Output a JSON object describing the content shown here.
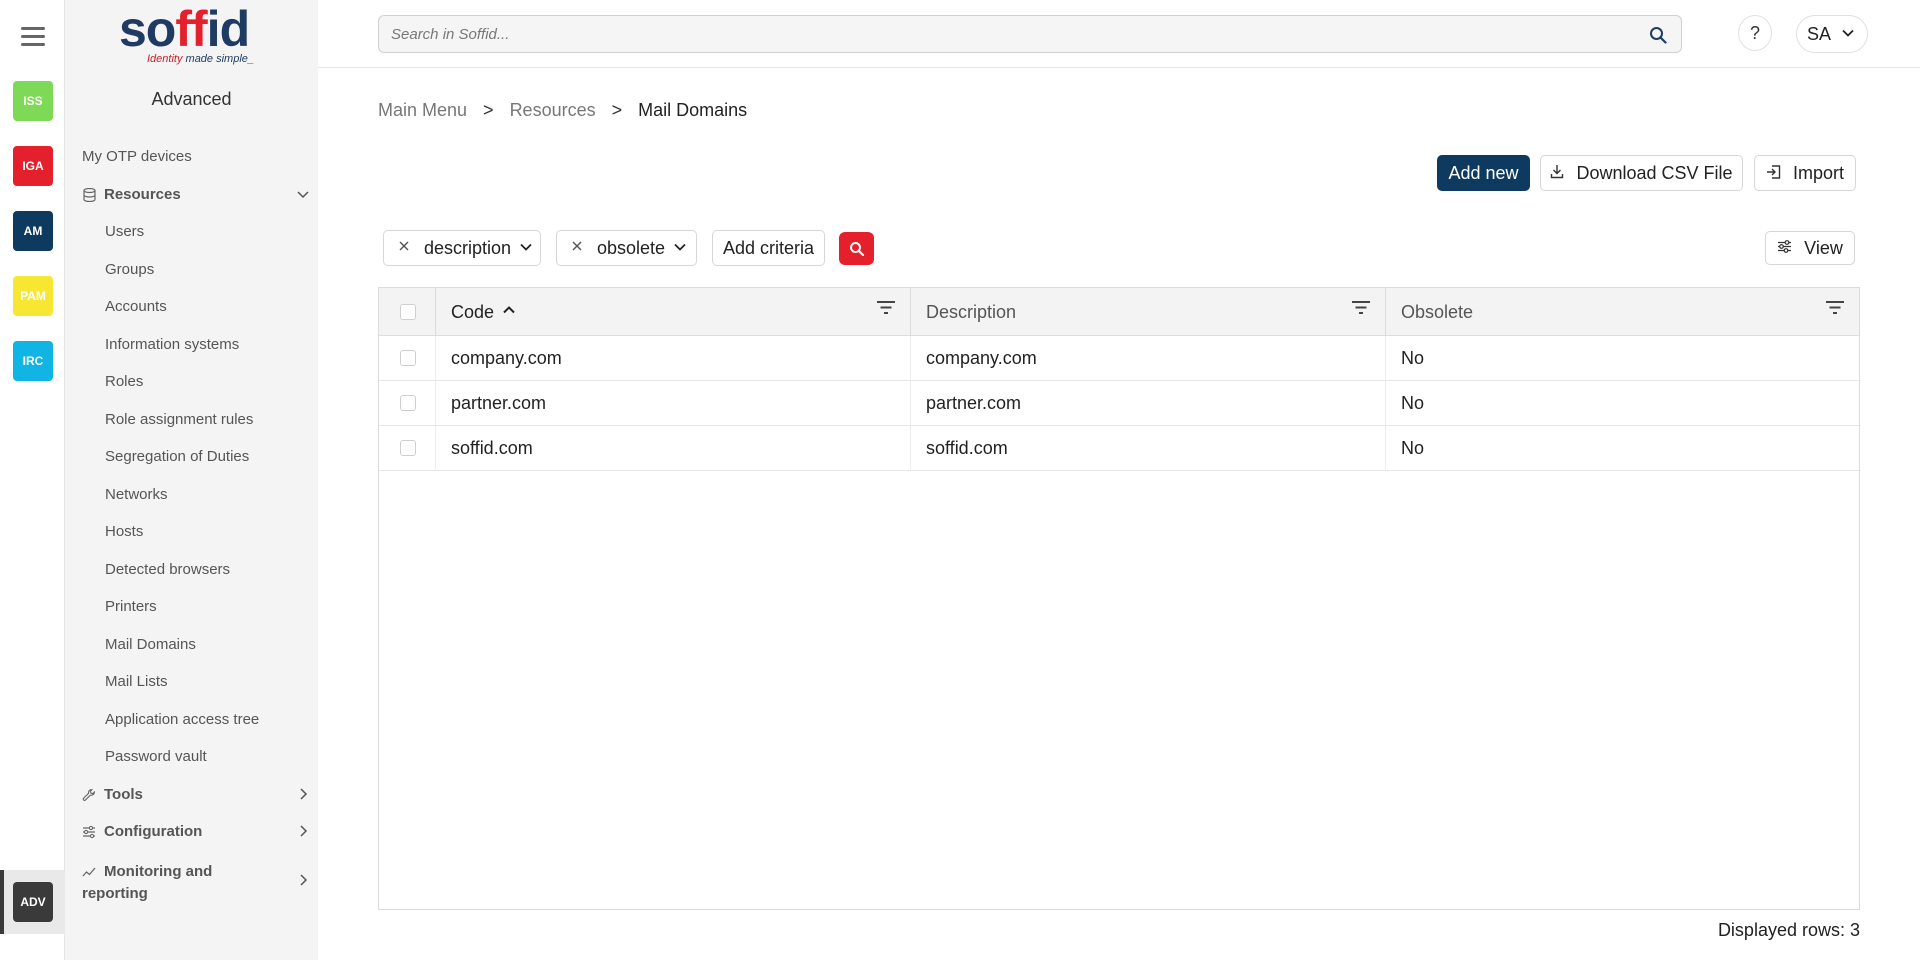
{
  "rail": {
    "apps": [
      {
        "label": "ISS",
        "color": "#7ed957"
      },
      {
        "label": "IGA",
        "color": "#e3202b"
      },
      {
        "label": "AM",
        "color": "#0f3a5f"
      },
      {
        "label": "PAM",
        "color": "#f7e733"
      },
      {
        "label": "IRC",
        "color": "#11b5e4"
      }
    ],
    "active_app": {
      "label": "ADV",
      "color": "#3a3a3a"
    }
  },
  "sidebar": {
    "logo_tag_1": "Identity",
    "logo_tag_2": "made simple_",
    "heading": "Advanced",
    "top_item": "My OTP devices",
    "resources_label": "Resources",
    "resources_items": [
      "Users",
      "Groups",
      "Accounts",
      "Information systems",
      "Roles",
      "Role assignment rules",
      "Segregation of Duties",
      "Networks",
      "Hosts",
      "Detected browsers",
      "Printers",
      "Mail Domains",
      "Mail Lists",
      "Application access tree",
      "Password vault"
    ],
    "tools_label": "Tools",
    "configuration_label": "Configuration",
    "monitoring_label_1": "Monitoring and",
    "monitoring_label_2": "reporting"
  },
  "topbar": {
    "search_placeholder": "Search in Soffid...",
    "help_label": "?",
    "user_initials": "SA"
  },
  "breadcrumb": {
    "items": [
      "Main Menu",
      "Resources"
    ],
    "separator": ">",
    "current": "Mail Domains"
  },
  "actions": {
    "add_new": "Add new",
    "download_csv": "Download CSV File",
    "import": "Import",
    "view": "View"
  },
  "criteria": {
    "chips": [
      "description",
      "obsolete"
    ],
    "add_criteria": "Add criteria"
  },
  "table": {
    "columns": [
      "Code",
      "Description",
      "Obsolete"
    ],
    "sorted_column": "Code",
    "rows": [
      [
        "company.com",
        "company.com",
        "No"
      ],
      [
        "partner.com",
        "partner.com",
        "No"
      ],
      [
        "soffid.com",
        "soffid.com",
        "No"
      ]
    ],
    "displayed_rows_label": "Displayed rows: 3"
  }
}
